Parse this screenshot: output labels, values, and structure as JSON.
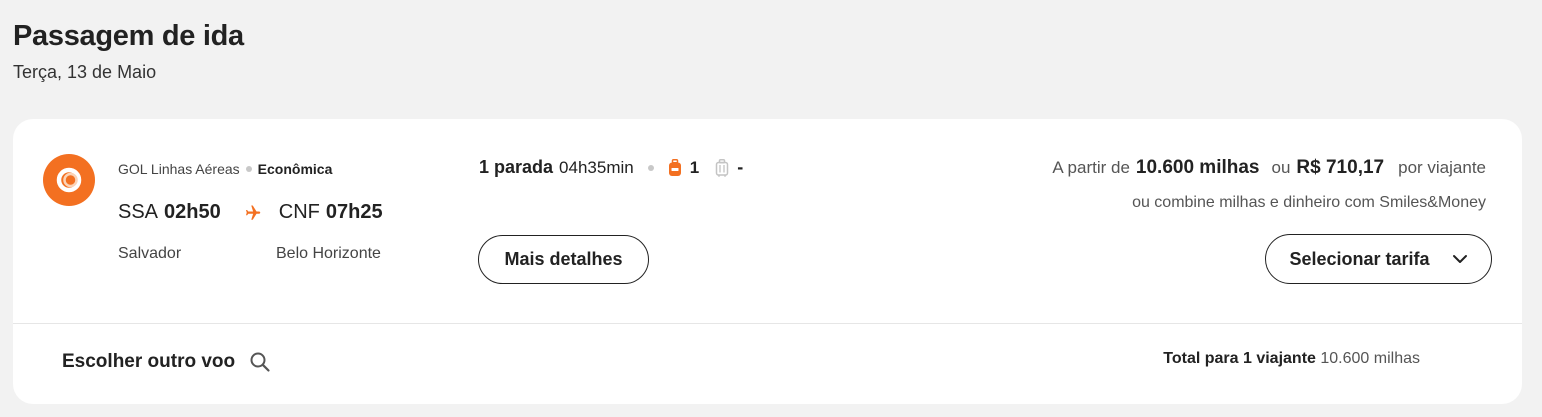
{
  "header": {
    "title": "Passagem de ida",
    "date": "Terça, 13 de Maio"
  },
  "flight": {
    "airline": "GOL Linhas Aéreas",
    "cabin": "Econômica",
    "origin_code": "SSA",
    "departure_time": "02h50",
    "destination_code": "CNF",
    "arrival_time": "07h25",
    "origin_city": "Salvador",
    "destination_city": "Belo Horizonte",
    "stops": "1 parada",
    "duration": "04h35min",
    "carry_on_count": "1",
    "checked_bag": "-",
    "details_button": "Mais detalhes"
  },
  "pricing": {
    "from_label": "A partir de",
    "miles": "10.600 milhas",
    "or_label": "ou",
    "money": "R$ 710,17",
    "per_traveler": "por viajante",
    "combine_text": "ou combine milhas e dinheiro com Smiles&Money",
    "select_button": "Selecionar tarifa"
  },
  "footer": {
    "choose_other": "Escolher outro voo",
    "total_label": "Total para 1 viajante",
    "total_value": "10.600 milhas"
  },
  "icons": {
    "logo": "gol-logo-icon",
    "plane": "plane-icon",
    "backpack": "backpack-icon",
    "trolley": "trolley-bag-icon",
    "chevron": "chevron-down-icon",
    "search": "search-icon"
  },
  "colors": {
    "accent": "#f37021",
    "background": "#f2f2f2",
    "card": "#ffffff",
    "text": "#222222"
  }
}
